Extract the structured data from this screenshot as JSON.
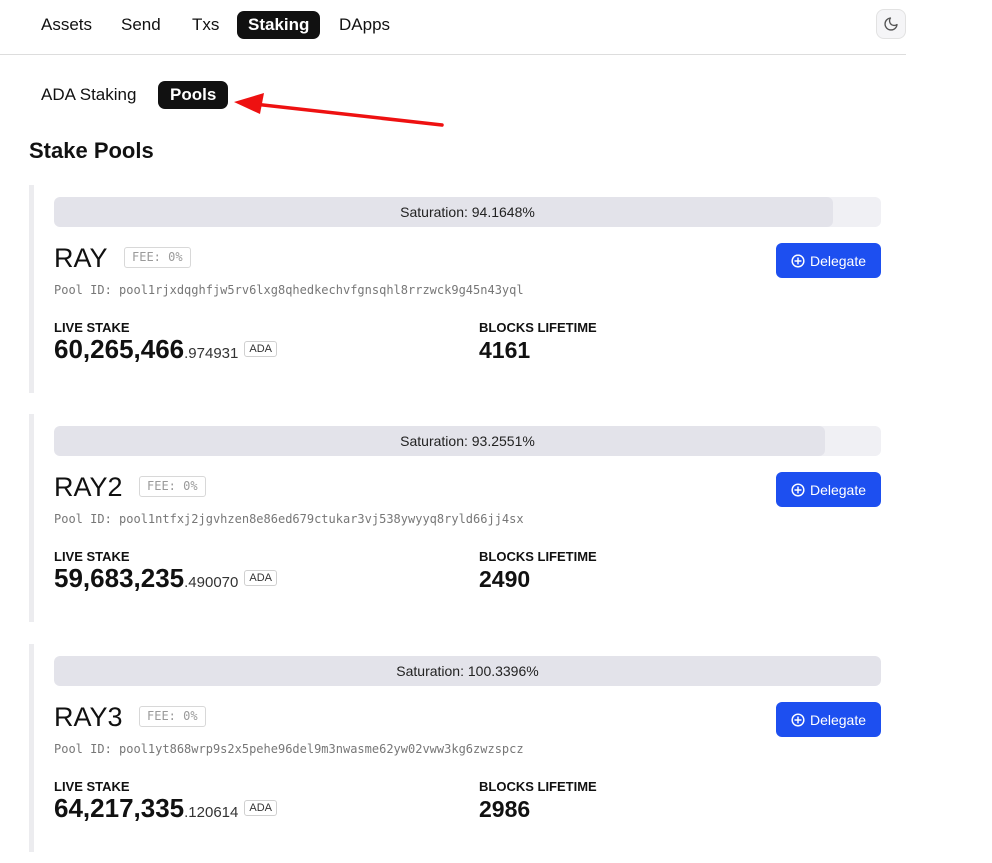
{
  "nav": {
    "tabs": [
      {
        "label": "Assets"
      },
      {
        "label": "Send"
      },
      {
        "label": "Txs"
      },
      {
        "label": "Staking"
      },
      {
        "label": "DApps"
      }
    ],
    "active_tab": "Staking",
    "theme_icon": "moon-icon"
  },
  "subnav": {
    "tabs": [
      {
        "label": "ADA Staking"
      },
      {
        "label": "Pools"
      }
    ],
    "active_tab": "Pools"
  },
  "annotation": {
    "arrow_color": "#ee1111"
  },
  "page": {
    "title": "Stake Pools"
  },
  "pools": [
    {
      "saturation_label": "Saturation: 94.1648%",
      "saturation_fraction": 0.941648,
      "name": "RAY",
      "fee": "FEE: 0%",
      "pool_id": "Pool ID: pool1rjxdqghfjw5rv6lxg8qhedkechvfgnsqhl8rrzwck9g45n43yql",
      "delegate_label": "Delegate",
      "live_stake_label": "LIVE STAKE",
      "live_stake_int": "60,265,466",
      "live_stake_dec": ".974931",
      "currency": "ADA",
      "blocks_label": "BLOCKS LIFETIME",
      "blocks_value": "4161"
    },
    {
      "saturation_label": "Saturation: 93.2551%",
      "saturation_fraction": 0.932551,
      "name": "RAY2",
      "fee": "FEE: 0%",
      "pool_id": "Pool ID: pool1ntfxj2jgvhzen8e86ed679ctukar3vj538ywyyq8ryld66jj4sx",
      "delegate_label": "Delegate",
      "live_stake_label": "LIVE STAKE",
      "live_stake_int": "59,683,235",
      "live_stake_dec": ".490070",
      "currency": "ADA",
      "blocks_label": "BLOCKS LIFETIME",
      "blocks_value": "2490"
    },
    {
      "saturation_label": "Saturation: 100.3396%",
      "saturation_fraction": 1.0,
      "name": "RAY3",
      "fee": "FEE: 0%",
      "pool_id": "Pool ID: pool1yt868wrp9s2x5pehe96del9m3nwasme62yw02vww3kg6zwzspcz",
      "delegate_label": "Delegate",
      "live_stake_label": "LIVE STAKE",
      "live_stake_int": "64,217,335",
      "live_stake_dec": ".120614",
      "currency": "ADA",
      "blocks_label": "BLOCKS LIFETIME",
      "blocks_value": "2986"
    }
  ],
  "colors": {
    "accent": "#1d4ff0",
    "active_tab_bg": "#111111"
  }
}
